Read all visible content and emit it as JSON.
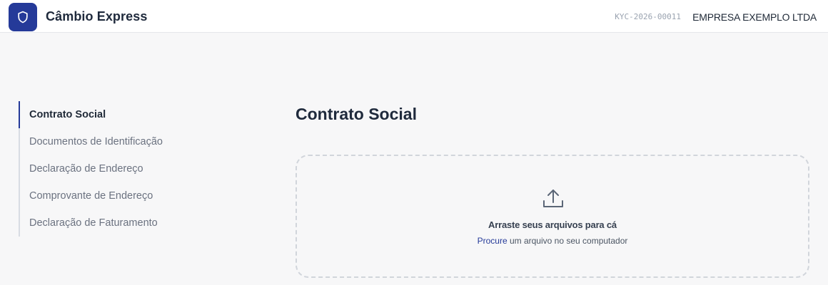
{
  "app": {
    "title": "Câmbio Express",
    "logo_icon": "shield-icon",
    "kyc_code": "KYC-2026-00011",
    "company": "EMPRESA EXEMPLO LTDA"
  },
  "sidebar": {
    "items": [
      {
        "label": "Contrato Social",
        "active": true
      },
      {
        "label": "Documentos de Identificação",
        "active": false
      },
      {
        "label": "Declaração de Endereço",
        "active": false
      },
      {
        "label": "Comprovante de Endereço",
        "active": false
      },
      {
        "label": "Declaração de Faturamento",
        "active": false
      }
    ]
  },
  "main": {
    "title": "Contrato Social",
    "dropzone": {
      "icon": "upload-icon",
      "title": "Arraste seus arquivos para cá",
      "link": "Procure",
      "subtitle_rest": " um arquivo no seu computador"
    }
  },
  "colors": {
    "brand": "#253a99",
    "background": "#f7f7f8",
    "border": "#d1d5db"
  }
}
